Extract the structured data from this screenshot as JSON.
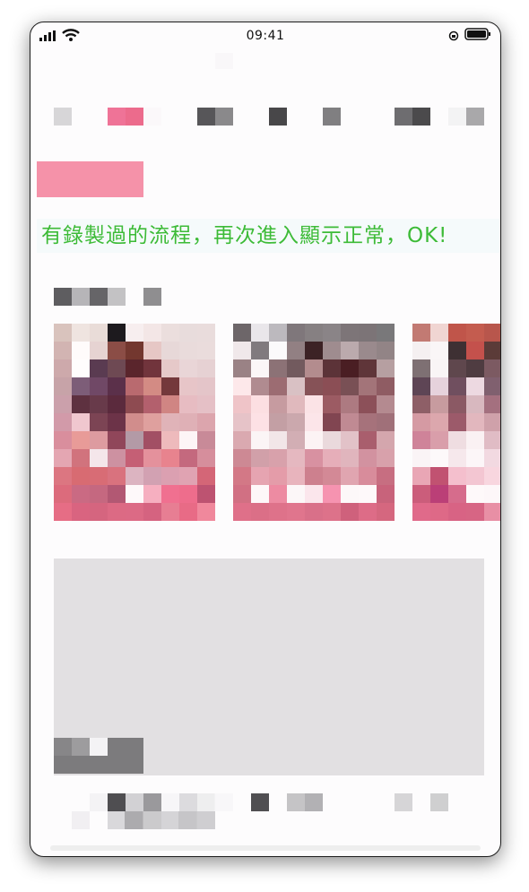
{
  "status_bar": {
    "time": "09:41",
    "left_icons": [
      "signal-bars-icon",
      "wifi-icon"
    ],
    "right_icons": [
      "orientation-lock-icon",
      "battery-icon"
    ]
  },
  "banner": {
    "message": "有錄製過的流程，再次進入顯示正常，OK!",
    "message_color": "#3dbb37",
    "tag_color": "#f592a9"
  },
  "accent_color": "#ef6f8e",
  "card_color": "#e2e0e2"
}
